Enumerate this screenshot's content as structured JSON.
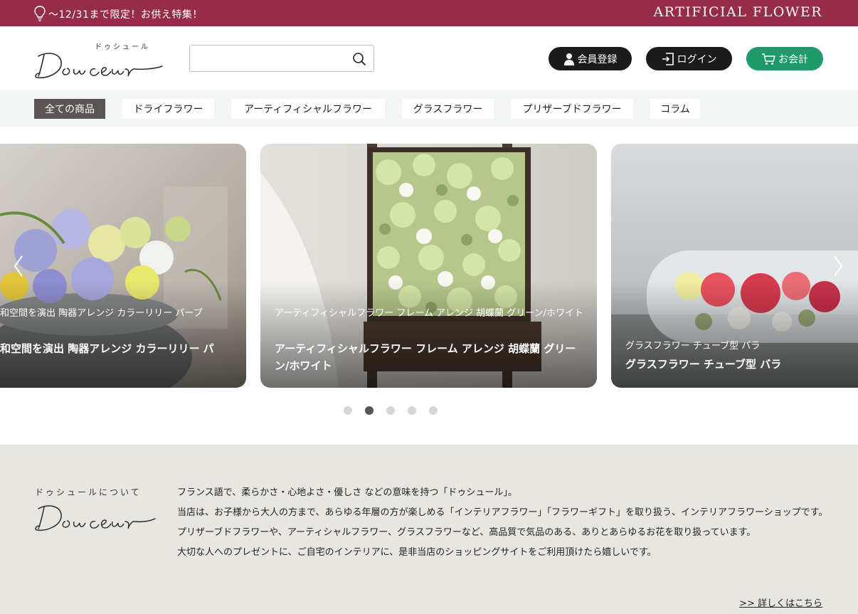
{
  "topbar": {
    "promo": "～12/31まで限定！お供え特集！",
    "brandline": "ARTIFICIAL FLOWER",
    "icon": "lightbulb-icon",
    "color": "#972c49"
  },
  "header": {
    "logo_kana": "ドゥシュール",
    "logo_text": "Douceur",
    "search": {
      "placeholder": "",
      "value": "",
      "icon": "search-icon"
    },
    "buttons": {
      "register": "会員登録",
      "login": "ログイン",
      "checkout": "お会計"
    },
    "colors": {
      "dark": "#1b1b1b",
      "green": "#1f9a6a"
    }
  },
  "categories": [
    {
      "label": "全ての商品",
      "active": true
    },
    {
      "label": "ドライフラワー",
      "active": false
    },
    {
      "label": "アーティフィシャルフラワー",
      "active": false
    },
    {
      "label": "グラスフラワー",
      "active": false
    },
    {
      "label": "プリザーブドフラワー",
      "active": false
    },
    {
      "label": "コラム",
      "active": false
    }
  ],
  "carousel": {
    "slides": [
      {
        "sub": "和空間を演出 陶器アレンジ カラーリリー パープ",
        "title": "和空間を演出 陶器アレンジ カラーリリー パ"
      },
      {
        "sub": "アーティフィシャルフラワー フレーム アレンジ 胡蝶蘭 グリーン/ホワイト",
        "title": "アーティフィシャルフラワー フレーム アレンジ 胡蝶蘭 グリーン/ホワイト"
      },
      {
        "sub": "グラスフラワー チューブ型 バラ",
        "title": "グラスフラワー チューブ型 バラ"
      }
    ],
    "dots": 5,
    "active_dot": 2
  },
  "about": {
    "label": "ドゥシュールについて",
    "logo_text": "Douceur",
    "paragraphs": [
      "フランス語で、柔らかさ・心地よさ・優しさ などの意味を持つ「ドゥシュール」。",
      "当店は、お子様から大人の方まで、あらゆる年層の方が楽しめる「インテリアフラワー」「フラワーギフト」を取り扱う、インテリアフラワーショップです。",
      "プリザーブドフラワーや、アーティシャルフラワー、グラスフラワーなど、高品質で気品のある、ありとあらゆるお花を取り扱っています。",
      "大切な人へのプレゼントに、ご自宅のインテリアに、是非当店のショッピングサイトをご利用頂けたら嬉しいです。"
    ],
    "more": ">> 詳しくはこちら"
  }
}
